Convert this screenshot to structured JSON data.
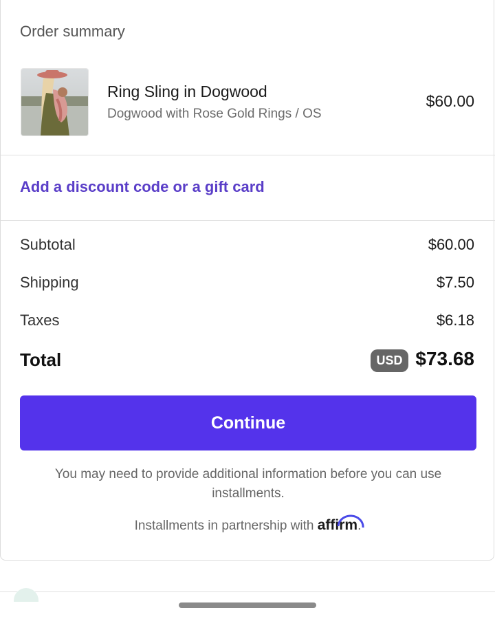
{
  "order_summary": {
    "heading": "Order summary",
    "item": {
      "name": "Ring Sling in Dogwood",
      "variant": "Dogwood with Rose Gold Rings / OS",
      "price": "$60.00",
      "thumbnail_icon": "product-photo"
    },
    "discount_link": "Add a discount code or a gift card",
    "rows": {
      "subtotal": {
        "label": "Subtotal",
        "value": "$60.00"
      },
      "shipping": {
        "label": "Shipping",
        "value": "$7.50"
      },
      "taxes": {
        "label": "Taxes",
        "value": "$6.18"
      }
    },
    "total": {
      "label": "Total",
      "currency": "USD",
      "value": "$73.68"
    }
  },
  "continue_label": "Continue",
  "notice": "You may need to provide additional information before you can use installments.",
  "partner": {
    "prefix": "Installments in partnership with",
    "brand": "affirm",
    "suffix": "."
  },
  "colors": {
    "accent": "#5433eb",
    "link": "#5a3ec8",
    "badge": "#666666"
  }
}
